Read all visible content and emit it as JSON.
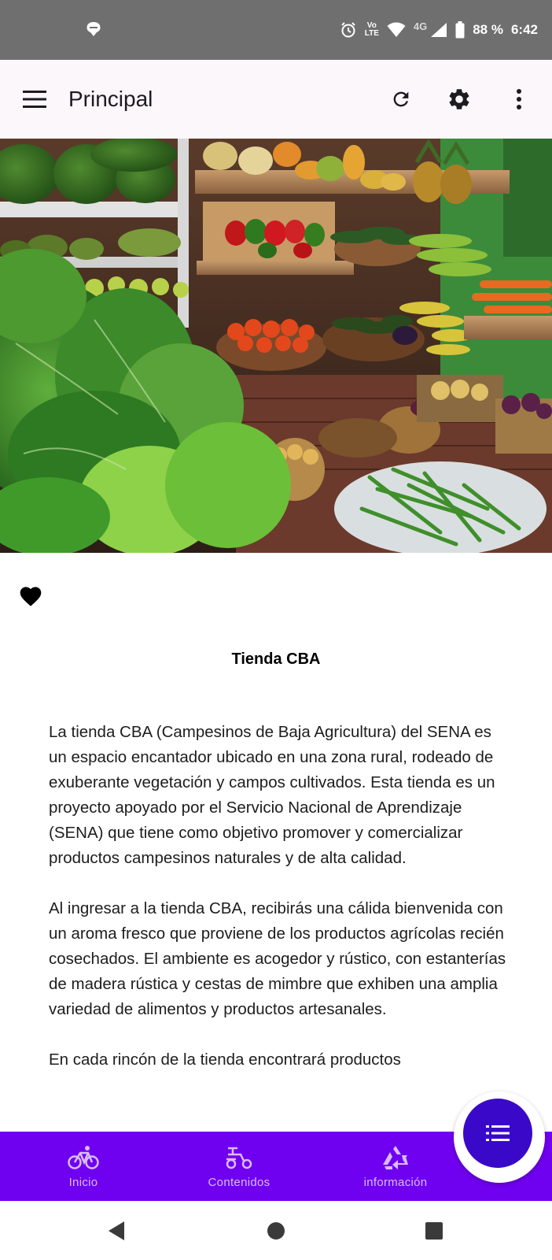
{
  "status_bar": {
    "battery": "88 %",
    "time": "6:42",
    "volte_top": "Vo",
    "volte_bottom": "LTE",
    "network": "4G"
  },
  "app_bar": {
    "title": "Principal",
    "background": "#fcf7fb"
  },
  "content": {
    "store_title": "Tienda CBA",
    "paragraphs": [
      "La tienda CBA (Campesinos de Baja Agricultura) del SENA es un espacio encantador ubicado en una zona rural, rodeado de exuberante vegetación y campos cultivados. Esta tienda es un proyecto apoyado por el Servicio Nacional de Aprendizaje (SENA) que tiene como objetivo promover y comercializar productos campesinos naturales y de alta calidad.",
      "Al ingresar a la tienda CBA, recibirás una cálida bienvenida con un aroma fresco que proviene de los productos agrícolas recién cosechados. El ambiente es acogedor y rústico, con estanterías de madera rústica y cestas de mimbre que exhiben una amplia variedad de alimentos y productos artesanales.",
      "En cada rincón de la tienda encontrará productos"
    ]
  },
  "bottom_nav": {
    "background": "#7000f0",
    "items": [
      {
        "label": "Inicio",
        "icon": "bicycle-icon"
      },
      {
        "label": "Contenidos",
        "icon": "scooter-icon"
      },
      {
        "label": "información",
        "icon": "recycle-icon"
      }
    ]
  },
  "fab": {
    "icon": "list-icon",
    "color": "#3a08c9"
  },
  "colors": {
    "accent": "#7000f0",
    "nav_label": "#d8bcff"
  }
}
